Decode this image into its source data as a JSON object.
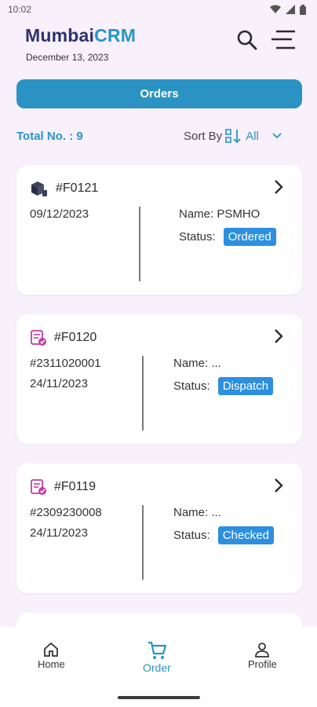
{
  "status_bar": {
    "time": "10:02"
  },
  "header": {
    "brand_main": "Mumbai",
    "brand_accent": "CRM",
    "date": "December 13, 2023"
  },
  "orders_button": {
    "label": "Orders"
  },
  "summary": {
    "total_label": "Total No. : 9",
    "sort_label": "Sort By",
    "sort_value": "All"
  },
  "orders": [
    {
      "id": "#F0121",
      "line1": "09/12/2023",
      "line2": "",
      "name": "Name: PSMHO",
      "status_label": "Status:",
      "status": "Ordered",
      "icon": "package-icon"
    },
    {
      "id": "#F0120",
      "line1": "#2311020001",
      "line2": "24/11/2023",
      "name": "Name: ...",
      "status_label": "Status:",
      "status": "Dispatch",
      "icon": "order-check-icon"
    },
    {
      "id": "#F0119",
      "line1": "#2309230008",
      "line2": "24/11/2023",
      "name": "Name: ...",
      "status_label": "Status:",
      "status": "Checked",
      "icon": "order-check-icon"
    }
  ],
  "bottom_nav": {
    "home": "Home",
    "order": "Order",
    "profile": "Profile"
  },
  "colors": {
    "accent": "#2b93c4",
    "brand": "#2d3270",
    "badge": "#2c8fe0",
    "background": "#f8f0fb"
  }
}
